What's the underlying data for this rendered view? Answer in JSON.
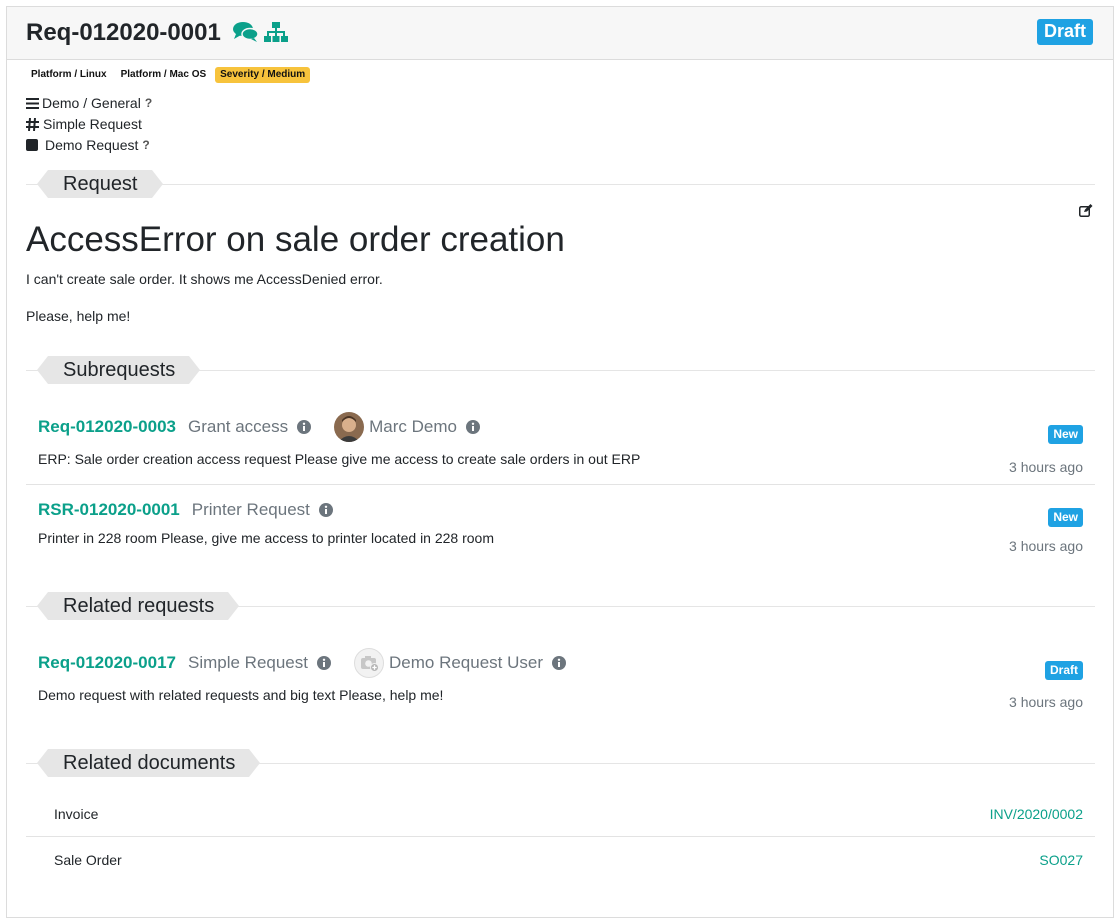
{
  "header": {
    "title": "Req-012020-0001",
    "state": "Draft",
    "chat_icon": "comments-icon",
    "structure_icon": "sitemap-icon"
  },
  "tags": [
    "Platform / Linux",
    "Platform / Mac OS",
    "Severity / Medium"
  ],
  "info": {
    "category": "Demo / General",
    "category_help": "?",
    "type": "Simple Request",
    "kind": "Demo Request",
    "kind_help": "?"
  },
  "request": {
    "section_label": "Request",
    "subject": "AccessError on sale order creation",
    "paragraphs": [
      "I can't create sale order. It shows me AccessDenied error.",
      "Please, help me!"
    ]
  },
  "subrequests": {
    "section_label": "Subrequests",
    "items": [
      {
        "ref": "Req-012020-0003",
        "type": "Grant access",
        "user": "Marc Demo",
        "description": "ERP: Sale order creation access request Please give me access to create sale orders in out ERP",
        "state": "New",
        "time": "3 hours ago"
      },
      {
        "ref": "RSR-012020-0001",
        "type": "Printer Request",
        "description": "Printer in 228 room Please, give me access to printer located in 228 room",
        "state": "New",
        "time": "3 hours ago"
      }
    ]
  },
  "related_requests": {
    "section_label": "Related requests",
    "items": [
      {
        "ref": "Req-012020-0017",
        "type": "Simple Request",
        "user": "Demo Request User",
        "description": "Demo request with related requests and big text Please, help me!",
        "state": "Draft",
        "time": "3 hours ago"
      }
    ]
  },
  "related_documents": {
    "section_label": "Related documents",
    "rows": [
      {
        "label": "Invoice",
        "value": "INV/2020/0002"
      },
      {
        "label": "Sale Order",
        "value": "SO027"
      }
    ]
  },
  "colors": {
    "accent": "#0ba08a",
    "badge": "#1fa2e3",
    "warning": "#f7c33c"
  }
}
